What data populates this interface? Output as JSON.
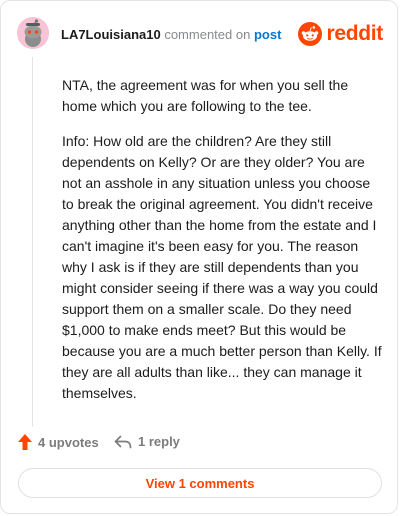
{
  "comment": {
    "username": "LA7Louisiana10",
    "action_text": "commented on",
    "post_link": "post",
    "paragraphs": [
      "NTA, the agreement was for when you sell the home which you are following to the tee.",
      "Info: How old are the children? Are they still dependents on Kelly? Or are they older? You are not an asshole in any situation unless you choose to break the original agreement. You didn't receive anything other than the home from the estate and I can't imagine it's been easy for you. The reason why I ask is if they are still dependents than you might consider seeing if there was a way you could support them on a smaller scale. Do they need $1,000 to make ends meet? But this would be because you are a much better person than Kelly. If they are all adults than like... they can manage it themselves."
    ]
  },
  "brand": {
    "wordmark": "reddit",
    "color": "#ff4500"
  },
  "actions": {
    "upvotes_label": "4 upvotes",
    "reply_label": "1 reply"
  },
  "footer": {
    "view_comments_label": "View 1 comments"
  },
  "icons": {
    "avatar": "snoo-avatar-icon",
    "logo": "reddit-logo-icon",
    "upvote": "upvote-arrow-icon",
    "reply": "reply-arrow-icon"
  },
  "colors": {
    "accent": "#ff4500",
    "link": "#0079d3",
    "muted": "#878a8c"
  }
}
